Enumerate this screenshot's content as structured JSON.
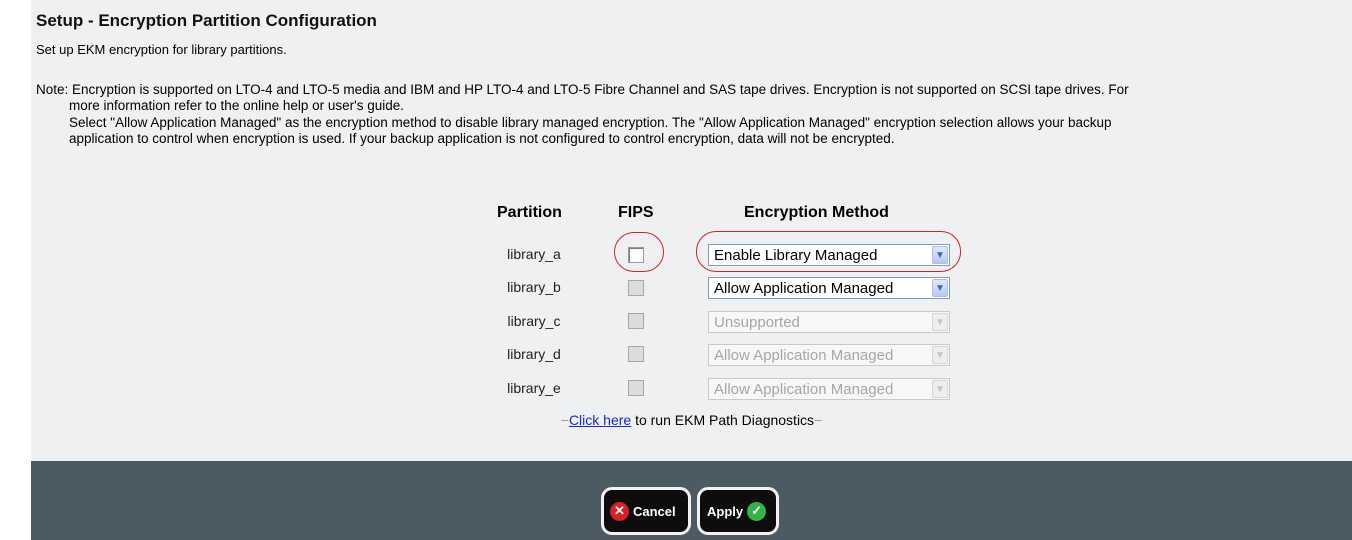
{
  "page": {
    "title": "Setup - Encryption Partition Configuration",
    "subtitle": "Set up EKM encryption for library partitions.",
    "note_line1": "Note: Encryption is supported on LTO-4 and LTO-5 media and IBM and HP LTO-4 and LTO-5 Fibre Channel and SAS tape drives. Encryption is not supported on SCSI tape drives. For",
    "note_line2": "more information refer to the online help or user's guide.",
    "note_line3": "Select \"Allow Application Managed\" as the encryption method to disable library managed encryption. The \"Allow Application Managed\" encryption selection allows your backup",
    "note_line4": "application to control when encryption is used. If your backup application is not configured to control encryption, data will not be encrypted."
  },
  "table": {
    "headers": {
      "partition": "Partition",
      "fips": "FIPS",
      "method": "Encryption Method"
    },
    "rows": [
      {
        "partition": "library_a",
        "fips_checked": false,
        "fips_enabled": true,
        "method": "Enable Library Managed",
        "method_enabled": true
      },
      {
        "partition": "library_b",
        "fips_checked": false,
        "fips_enabled": false,
        "method": "Allow Application Managed",
        "method_enabled": true
      },
      {
        "partition": "library_c",
        "fips_checked": false,
        "fips_enabled": false,
        "method": "Unsupported",
        "method_enabled": false
      },
      {
        "partition": "library_d",
        "fips_checked": false,
        "fips_enabled": false,
        "method": "Allow Application Managed",
        "method_enabled": false
      },
      {
        "partition": "library_e",
        "fips_checked": false,
        "fips_enabled": false,
        "method": "Allow Application Managed",
        "method_enabled": false
      }
    ]
  },
  "diagnostics": {
    "link_text": "Click here",
    "suffix_text": " to run EKM Path Diagnostics",
    "dash": "−"
  },
  "buttons": {
    "cancel": "Cancel",
    "apply": "Apply"
  },
  "icons": {
    "dropdown": "chevron-down-icon",
    "cancel": "x-circle-icon",
    "apply": "checkmark-circle-icon"
  },
  "colors": {
    "highlight_circle": "#d0232a",
    "footer_bg": "#4c5a63",
    "link": "#1a26d8"
  }
}
